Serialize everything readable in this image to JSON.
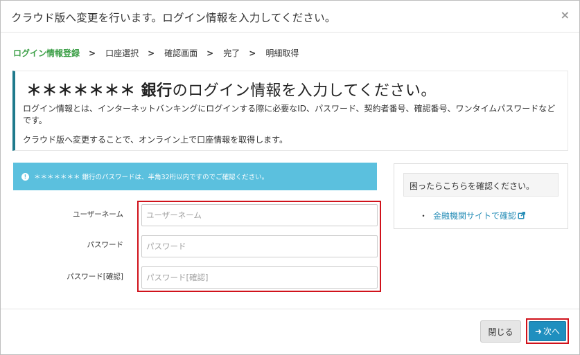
{
  "dialog": {
    "title": "クラウド版へ変更を行います。ログイン情報を入力してください。",
    "close_glyph": "×"
  },
  "steps": [
    {
      "label": "ログイン情報登録",
      "active": true
    },
    {
      "label": "口座選択",
      "active": false
    },
    {
      "label": "確認画面",
      "active": false
    },
    {
      "label": "完了",
      "active": false
    },
    {
      "label": "明細取得",
      "active": false
    }
  ],
  "step_separator": ">",
  "bank_panel": {
    "bank_name": "＊＊＊＊＊＊＊ 銀行",
    "heading_suffix": "のログイン情報を入力してください。",
    "description": "ログイン情報とは、インターネットバンキングにログインする際に必要なID、パスワード、契約者番号、確認番号、ワンタイムパスワードなどです。",
    "description2": "クラウド版へ変更することで、オンライン上で口座情報を取得します。",
    "accent_color": "#1f7a8c"
  },
  "info_alert": {
    "text": "＊＊＊＊＊＊＊ 銀行のパスワードは、半角32桁以内ですのでご確認ください。",
    "icon": "exclamation-circle-icon",
    "color": "#5bc0de"
  },
  "form": {
    "username": {
      "label": "ユーザーネーム",
      "placeholder": "ユーザーネーム",
      "value": ""
    },
    "password": {
      "label": "パスワード",
      "placeholder": "パスワード",
      "value": ""
    },
    "password_confirm": {
      "label": "パスワード[確認]",
      "placeholder": "パスワード[確認]",
      "value": ""
    },
    "highlight_color": "#d0121b"
  },
  "help": {
    "heading": "困ったらこちらを確認ください。",
    "bullet": "・",
    "link_label": "金融機関サイトで確認",
    "link_icon": "external-link-icon",
    "link_color": "#2a8fb8"
  },
  "footer": {
    "close_label": "閉じる",
    "next_label": "次へ",
    "next_icon": "arrow-right-icon",
    "next_color": "#1f8fbf"
  }
}
